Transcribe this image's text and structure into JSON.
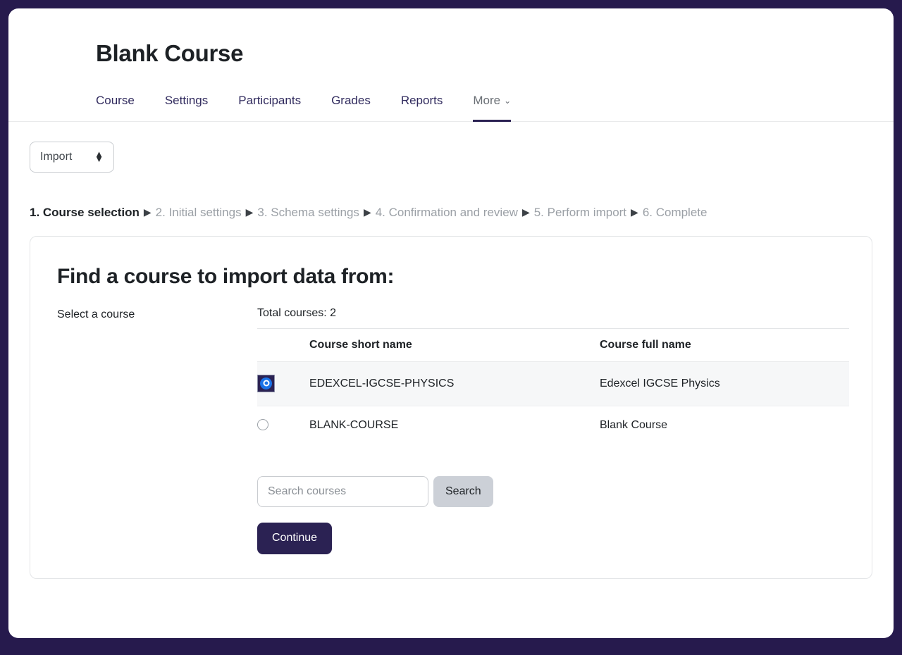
{
  "header": {
    "title": "Blank Course"
  },
  "tabs": [
    {
      "label": "Course",
      "active": false,
      "muted": false,
      "caret": false
    },
    {
      "label": "Settings",
      "active": false,
      "muted": false,
      "caret": false
    },
    {
      "label": "Participants",
      "active": false,
      "muted": false,
      "caret": false
    },
    {
      "label": "Grades",
      "active": false,
      "muted": false,
      "caret": false
    },
    {
      "label": "Reports",
      "active": false,
      "muted": false,
      "caret": false
    },
    {
      "label": "More",
      "active": true,
      "muted": true,
      "caret": true
    }
  ],
  "action_select": {
    "value": "Import",
    "icon": "up-down-chevrons-icon"
  },
  "steps": [
    {
      "label": "1. Course selection",
      "current": true
    },
    {
      "label": "2. Initial settings",
      "current": false
    },
    {
      "label": "3. Schema settings",
      "current": false
    },
    {
      "label": "4. Confirmation and review",
      "current": false
    },
    {
      "label": "5. Perform import",
      "current": false
    },
    {
      "label": "6. Complete",
      "current": false
    }
  ],
  "step_separator": "▶",
  "import_card": {
    "heading": "Find a course to import data from:",
    "select_label": "Select a course",
    "total_courses": "Total courses: 2",
    "table": {
      "headers": [
        "",
        "Course short name",
        "Course full name"
      ],
      "rows": [
        {
          "selected": true,
          "short_name": "EDEXCEL-IGCSE-PHYSICS",
          "full_name": "Edexcel IGCSE Physics"
        },
        {
          "selected": false,
          "short_name": "BLANK-COURSE",
          "full_name": "Blank Course"
        }
      ]
    },
    "search": {
      "placeholder": "Search courses",
      "value": "",
      "button_label": "Search"
    },
    "continue_label": "Continue"
  },
  "colors": {
    "page_background": "#261a4d",
    "brand_dark": "#2b2253",
    "accent_radio": "#1a73e8",
    "muted_text": "#9ba0a6",
    "search_button": "#ccd0d7"
  }
}
